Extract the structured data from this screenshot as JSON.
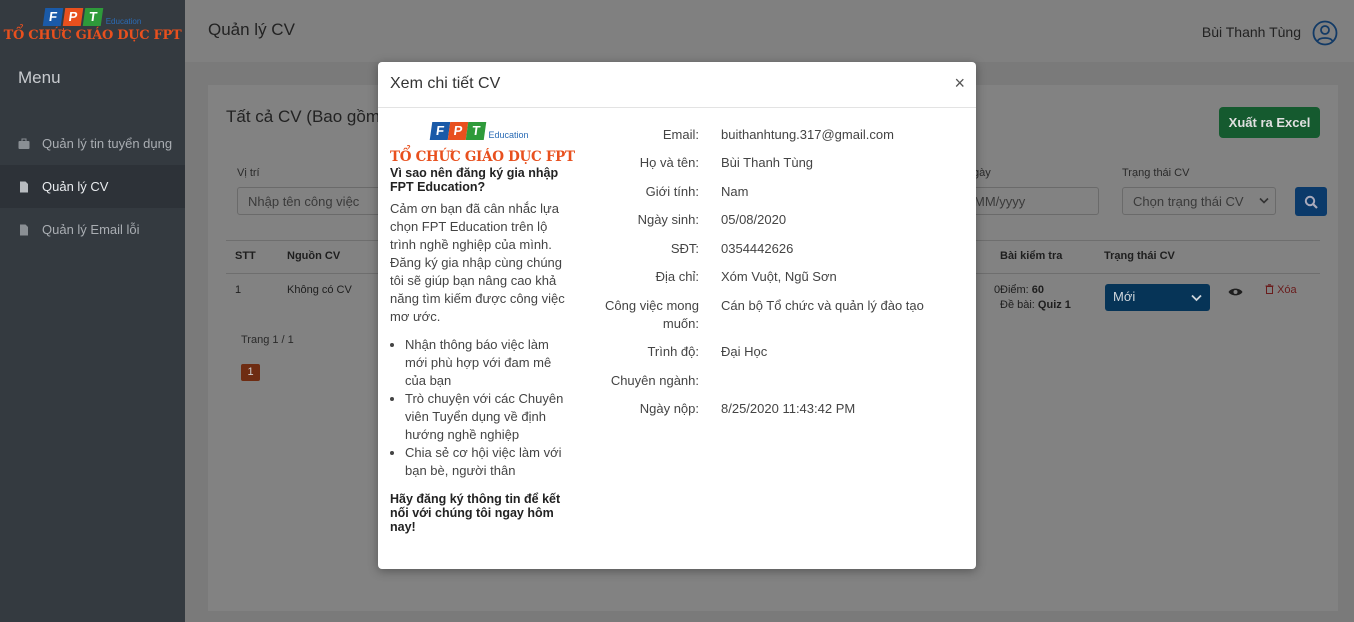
{
  "brand": {
    "logo_letters": [
      "F",
      "P",
      "T"
    ],
    "logo_colors": [
      "#1a5aa8",
      "#e8501e",
      "#2e9a3a"
    ],
    "edu": "Education",
    "org": "TỔ CHỨC GIÁO DỤC FPT"
  },
  "sidebar": {
    "menu_title": "Menu",
    "items": [
      {
        "label": "Quản lý tin tuyển dụng",
        "icon": "briefcase-icon"
      },
      {
        "label": "Quản lý CV",
        "icon": "file-icon"
      },
      {
        "label": "Quản lý Email lỗi",
        "icon": "file-icon"
      }
    ]
  },
  "header": {
    "title": "Quản lý CV",
    "user_name": "Bùi Thanh Tùng"
  },
  "card": {
    "title": "Tất cả CV (Bao gồm",
    "excel_label": "Xuất ra Excel",
    "filters": {
      "position_label": "Vị trí",
      "position_placeholder": "Nhập tên công việc",
      "date_label": "gày",
      "date_placeholder": "MM/yyyy",
      "status_label": "Trạng thái CV",
      "status_value": "Chọn trạng thái CV"
    },
    "table": {
      "headers": {
        "stt": "STT",
        "source": "Nguồn CV",
        "test": "Bài kiểm tra",
        "status": "Trạng thái CV"
      },
      "rows": [
        {
          "stt": "1",
          "source": "Không có CV",
          "partial": "0",
          "score_label": "Điểm:",
          "score": "60",
          "exam_label": "Đề bài:",
          "exam": "Quiz 1",
          "status": "Mới",
          "delete_label": "Xóa"
        }
      ]
    },
    "pagination": {
      "info": "Trang 1 / 1",
      "current": "1"
    }
  },
  "modal": {
    "title": "Xem chi tiết CV",
    "close": "×",
    "left": {
      "org": "TỔ CHỨC GIÁO DỤC FPT",
      "question": "Vì sao nên đăng ký gia nhập FPT Education?",
      "paragraph": "Cảm ơn bạn đã cân nhắc lựa chọn FPT Education trên lộ trình nghề nghiệp của mình. Đăng ký gia nhập cùng chúng tôi sẽ giúp bạn nâng cao khả năng tìm kiếm được công việc mơ ước.",
      "bullets": [
        "Nhận thông báo việc làm mới phù hợp với đam mê của bạn",
        "Trò chuyện với các Chuyên viên Tuyển dụng về định hướng nghề nghiệp",
        "Chia sẻ cơ hội việc làm với bạn bè, người thân"
      ],
      "cta": "Hãy đăng ký thông tin để kết nối với chúng tôi ngay hôm nay!"
    },
    "details": [
      {
        "label": "Email:",
        "value": "buithanhtung.317@gmail.com"
      },
      {
        "label": "Họ và tên:",
        "value": "Bùi Thanh Tùng"
      },
      {
        "label": "Giới tính:",
        "value": "Nam"
      },
      {
        "label": "Ngày sinh:",
        "value": "05/08/2020"
      },
      {
        "label": "SĐT:",
        "value": "0354442626"
      },
      {
        "label": "Địa chỉ:",
        "value": "Xóm Vuột, Ngũ Sơn"
      },
      {
        "label": "Công việc mong muốn:",
        "value": "Cán bộ Tổ chức và quản lý đào tạo"
      },
      {
        "label": "Trình độ:",
        "value": "Đại Học"
      },
      {
        "label": "Chuyên ngành:",
        "value": ""
      },
      {
        "label": "Ngày nộp:",
        "value": "8/25/2020 11:43:42 PM"
      }
    ]
  }
}
